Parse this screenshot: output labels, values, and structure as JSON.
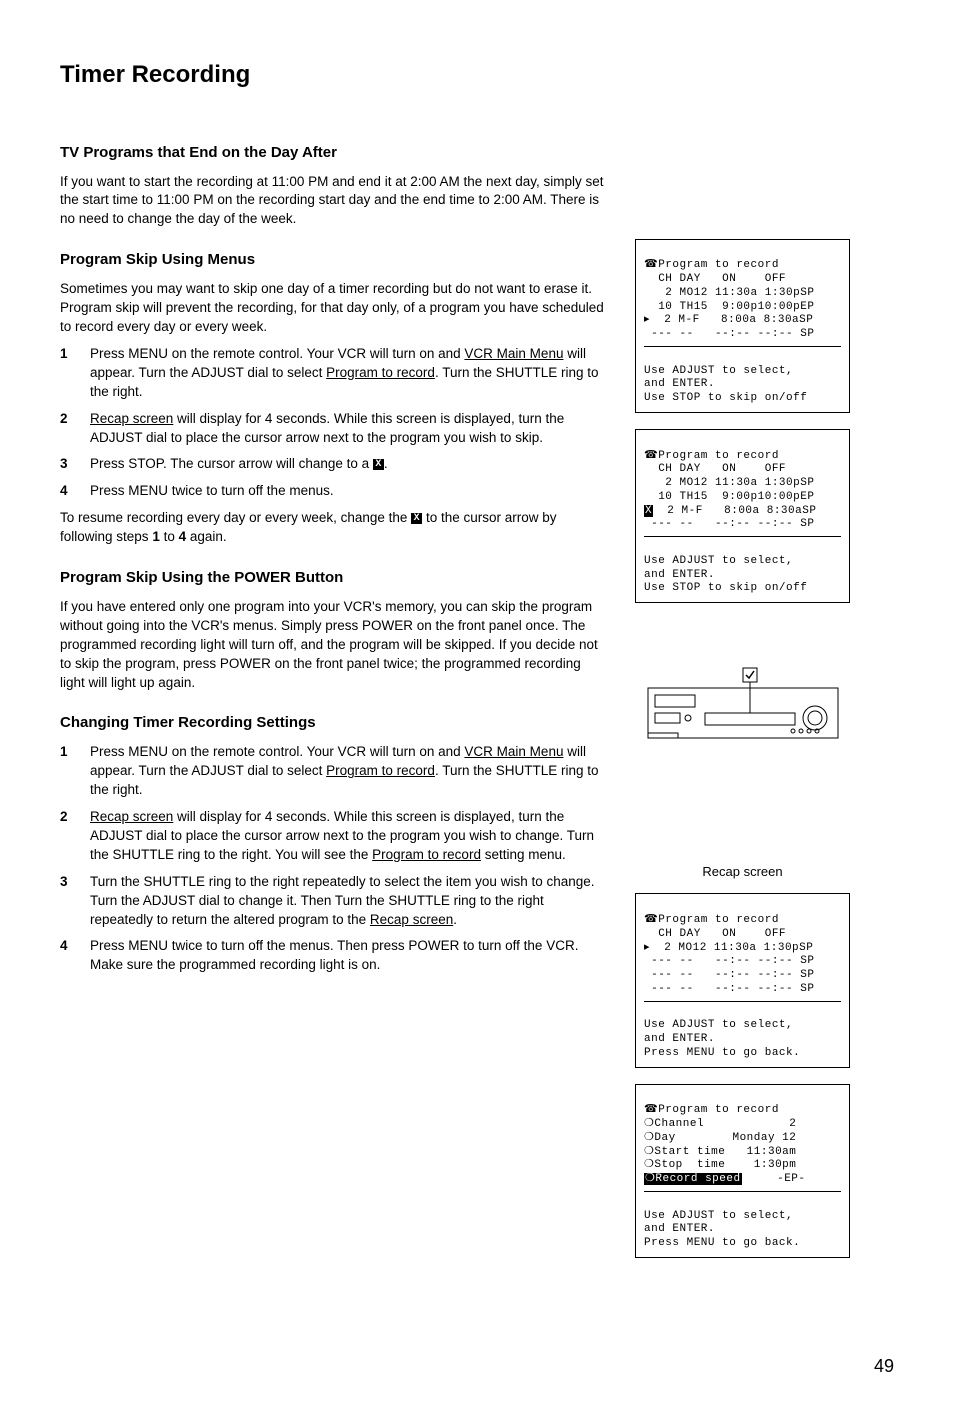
{
  "title": "Timer Recording",
  "sections": {
    "dayAfter": {
      "heading": "TV Programs that End on the Day After",
      "body": "If you want to start the recording at 11:00 PM and end it at 2:00 AM the next day, simply set the start time to 11:00 PM on the recording start day and the end time to 2:00 AM.  There is no need to change the day of the week."
    },
    "skipMenus": {
      "heading": "Program Skip Using Menus",
      "intro": "Sometimes you may want to skip one day of a timer recording but do not want to erase it.  Program skip will prevent the recording, for that day only, of a program you have scheduled to record every day or every week.",
      "step1_a": "Press MENU on the remote control.  Your VCR will turn on and ",
      "step1_u1": "VCR Main Menu",
      "step1_b": " will appear.  Turn the ADJUST dial to select ",
      "step1_u2": "Program to record",
      "step1_c": ".  Turn the SHUTTLE ring to the right.",
      "step2_u": "Recap screen",
      "step2_a": " will display for 4 seconds.  While this screen is displayed, turn the ADJUST dial to place the cursor arrow next to the program you wish to skip.",
      "step3_a": "Press STOP.  The cursor arrow will change to a ",
      "step3_b": ".",
      "step4": "Press MENU twice to turn off the menus.",
      "resume_a": "To resume recording every day or every week, change the ",
      "resume_b": " to the cursor arrow by following steps ",
      "resume_1": "1",
      "resume_to": " to ",
      "resume_4": "4",
      "resume_c": " again."
    },
    "skipPower": {
      "heading": "Program Skip Using the POWER Button",
      "body": "If you have entered only one program into your VCR's memory, you can skip the program without going into the VCR's menus.  Simply press POWER on the front panel once.  The programmed recording light will turn off, and the program will be skipped.  If you decide not to skip the program, press POWER on the front panel twice; the programmed recording light will light up again."
    },
    "changing": {
      "heading": "Changing Timer Recording Settings",
      "step1_a": "Press MENU on the remote control.  Your VCR will turn on and ",
      "step1_u1": "VCR Main Menu",
      "step1_b": " will appear.  Turn the ADJUST dial to select ",
      "step1_u2": "Program to record",
      "step1_c": ".  Turn the SHUTTLE ring to the right.",
      "step2_u": "Recap screen",
      "step2_a": " will display for 4 seconds.  While this screen is displayed, turn the ADJUST dial to place the cursor arrow next to the program you wish to change.  Turn the SHUTTLE ring to the right.  You will see the ",
      "step2_u2": "Program to record",
      "step2_b": " setting menu.",
      "step3_a": "Turn the SHUTTLE ring to the right repeatedly to select the item you wish to change.  Turn the ADJUST dial to change it.  Then Turn the SHUTTLE ring to the right repeatedly to return the altered program to the ",
      "step3_u": "Recap screen",
      "step3_b": ".",
      "step4": "Press MENU twice to turn off the menus.  Then press POWER to turn off the VCR.  Make sure the programmed recording light is on."
    }
  },
  "recapCaption": "Recap screen",
  "osd": {
    "skip1_title": "☎Program to record",
    "skip1_body": "  CH DAY   ON    OFF\n   2 MO12 11:30a 1:30pSP\n  10 TH15  9:00p10:00pEP\n▸  2 M-F   8:00a 8:30aSP\n --- --   --:-- --:-- SP",
    "skip1_foot": "Use ADJUST to select,\nand ENTER.\nUse STOP to skip on/off",
    "skip2_body_a": "  CH DAY   ON    OFF\n   2 MO12 11:30a 1:30pSP\n  10 TH15  9:00p10:00pEP\n",
    "skip2_row_mark": "X",
    "skip2_row_rest": "  2 M-F   8:00a 8:30aSP",
    "skip2_body_b": " --- --   --:-- --:-- SP",
    "recap_body": "  CH DAY   ON    OFF\n▸  2 MO12 11:30a 1:30pSP\n --- --   --:-- --:-- SP\n --- --   --:-- --:-- SP\n --- --   --:-- --:-- SP",
    "recap_foot": "Use ADJUST to select,\nand ENTER.\nPress MENU to go back.",
    "setting_body_a": "❍Channel            2\n❍Day        Monday 12\n❍Start time   11:30am\n❍Stop  time    1:30pm\n",
    "setting_rec_label": "❍Record speed",
    "setting_rec_val": "-EP-",
    "setting_foot": "Use ADJUST to select,\nand ENTER.\nPress MENU to go back."
  },
  "pageNumber": "49"
}
